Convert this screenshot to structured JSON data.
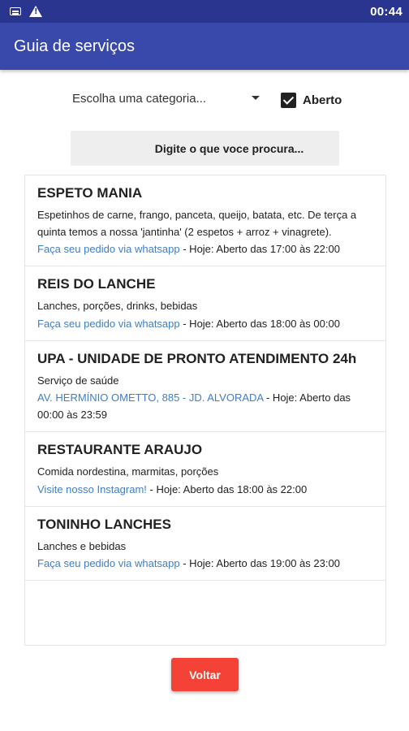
{
  "status_bar": {
    "time": "00:44",
    "icons": [
      "keyboard-icon",
      "warning-icon"
    ]
  },
  "app_bar": {
    "title": "Guia de serviços",
    "color": "#3949ab"
  },
  "filters": {
    "category_placeholder": "Escolha uma categoria...",
    "open_label": "Aberto",
    "open_checked": true
  },
  "search": {
    "placeholder": "Digite o que voce procura..."
  },
  "listings": [
    {
      "title": "ESPETO MANIA",
      "description": "Espetinhos de carne, frango, panceta, queijo, batata, etc. De terça a quinta temos a nossa 'jantinha' (2 espetos + arroz + vinagrete).",
      "link": "Faça seu pedido via whatsapp",
      "hours": " - Hoje: Aberto das 17:00 às 22:00"
    },
    {
      "title": "REIS DO LANCHE",
      "description": "Lanches, porções, drinks, bebidas",
      "link": "Faça seu pedido via whatsapp",
      "hours": " - Hoje: Aberto das 18:00 às 00:00"
    },
    {
      "title": "UPA - UNIDADE DE PRONTO ATENDIMENTO 24h",
      "description": "Serviço de saúde",
      "link": "AV. HERMÍNIO OMETTO, 885 - JD. ALVORADA",
      "hours": " - Hoje: Aberto das 00:00 às 23:59"
    },
    {
      "title": "RESTAURANTE ARAUJO",
      "description": "Comida nordestina, marmitas, porções",
      "link": "Visite nosso Instagram!",
      "hours": " - Hoje: Aberto das 18:00 às 22:00"
    },
    {
      "title": "TONINHO LANCHES",
      "description": "Lanches e bebidas",
      "link": "Faça seu pedido via whatsapp",
      "hours": " - Hoje: Aberto das 19:00 às 23:00"
    }
  ],
  "back_button": {
    "label": "Voltar",
    "color": "#f44336"
  }
}
